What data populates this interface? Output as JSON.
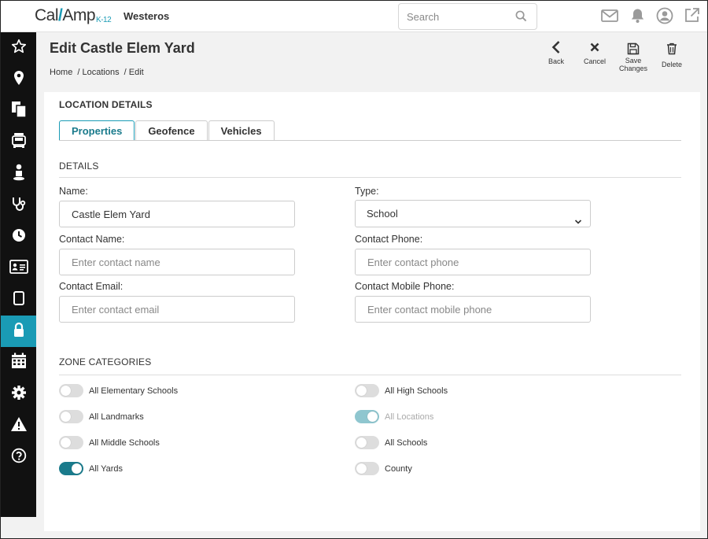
{
  "app": {
    "logo_main": "Cal",
    "logo_slash": "/",
    "logo_amp": "Amp",
    "logo_sub": "K-12",
    "org_name": "Westeros"
  },
  "search": {
    "placeholder": "Search"
  },
  "top_icons": [
    "mail-icon",
    "bell-icon",
    "user-icon",
    "external-link-icon"
  ],
  "sidebar": {
    "items": [
      {
        "icon": "star-icon"
      },
      {
        "icon": "map-pin-icon"
      },
      {
        "icon": "documents-icon"
      },
      {
        "icon": "bus-icon"
      },
      {
        "icon": "person-icon"
      },
      {
        "icon": "stethoscope-icon"
      },
      {
        "icon": "clock-icon"
      },
      {
        "icon": "id-card-icon"
      },
      {
        "icon": "tablet-icon"
      },
      {
        "icon": "lock-icon",
        "active": true
      },
      {
        "icon": "calendar-icon"
      },
      {
        "icon": "gear-icon"
      },
      {
        "icon": "warning-icon"
      },
      {
        "icon": "help-icon"
      }
    ],
    "active_color": "#1a9bb5"
  },
  "header": {
    "title": "Edit Castle Elem Yard",
    "breadcrumb": [
      "Home",
      "/ Locations",
      "/ Edit"
    ],
    "actions": {
      "back": "Back",
      "cancel": "Cancel",
      "save_line1": "Save",
      "save_line2": "Changes",
      "delete": "Delete"
    }
  },
  "panel": {
    "section_title": "LOCATION DETAILS",
    "tabs": [
      "Properties",
      "Geofence",
      "Vehicles"
    ],
    "active_tab": "Properties",
    "details": {
      "heading": "DETAILS",
      "name_label": "Name:",
      "name_value": "Castle Elem Yard",
      "type_label": "Type:",
      "type_value": "School",
      "contact_name_label": "Contact Name:",
      "contact_name_placeholder": "Enter contact name",
      "contact_phone_label": "Contact Phone:",
      "contact_phone_placeholder": "Enter contact phone",
      "contact_email_label": "Contact Email:",
      "contact_email_placeholder": "Enter contact email",
      "contact_mobile_label": "Contact Mobile Phone:",
      "contact_mobile_placeholder": "Enter contact mobile phone"
    },
    "zones": {
      "heading": "ZONE CATEGORIES",
      "left": [
        {
          "label": "All Elementary Schools",
          "on": false
        },
        {
          "label": "All Landmarks",
          "on": false
        },
        {
          "label": "All Middle Schools",
          "on": false
        },
        {
          "label": "All Yards",
          "on": true
        }
      ],
      "right": [
        {
          "label": "All High Schools",
          "on": false
        },
        {
          "label": "All Locations",
          "on": true,
          "disabled": true
        },
        {
          "label": "All Schools",
          "on": false
        },
        {
          "label": "County",
          "on": false
        }
      ]
    }
  }
}
